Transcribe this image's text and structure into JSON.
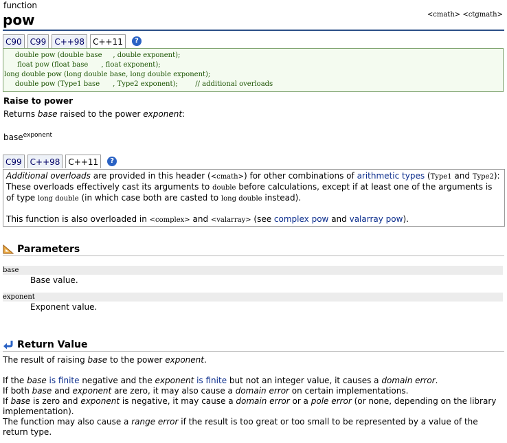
{
  "header": {
    "kind": "function",
    "title": "pow",
    "headers": "<cmath> <ctgmath>"
  },
  "tabs1": [
    "C90",
    "C99",
    "C++98",
    "C++11"
  ],
  "tabs1_active": "C++11",
  "help_label": "?",
  "prototypes": [
    "     double pow (double base     , double exponent);",
    "      float pow (float base      , float exponent);",
    "long double pow (long double base, long double exponent);",
    "     double pow (Type1 base      , Type2 exponent);        // additional overloads"
  ],
  "subtitle": "Raise to power",
  "description": {
    "pre": "Returns ",
    "base": "base",
    "mid": " raised to the power ",
    "exp": "exponent",
    "post": ":"
  },
  "formula": {
    "base": "base",
    "exp": "exponent"
  },
  "tabs2": [
    "C99",
    "C++98",
    "C++11"
  ],
  "tabs2_active": "C++11",
  "note": {
    "l1_em": "Additional overloads",
    "l1_a": " are provided in this header (",
    "l1_code": "<cmath>",
    "l1_b": ") for other combinations of ",
    "l1_link": "arithmetic types",
    "l1_c": " (",
    "l1_t1": "Type1",
    "l1_and": " and ",
    "l1_t2": "Type2",
    "l1_d": "):",
    "l2_a": "These overloads effectively cast its arguments to ",
    "l2_code": "double",
    "l2_b": " before calculations, except if at least one of the arguments is",
    "l3_a": "of type ",
    "l3_code1": "long double",
    "l3_b": " (in which case both are casted to ",
    "l3_code2": "long double",
    "l3_c": " instead).",
    "l4_a": "This function is also overloaded in ",
    "l4_code1": "<complex>",
    "l4_and": " and ",
    "l4_code2": "<valarray>",
    "l4_b": " (see ",
    "l4_link1": "complex pow",
    "l4_and2": " and ",
    "l4_link2": "valarray pow",
    "l4_c": ")."
  },
  "parameters": {
    "title": "Parameters",
    "items": [
      {
        "name": "base",
        "desc": "Base value."
      },
      {
        "name": "exponent",
        "desc": "Exponent value."
      }
    ]
  },
  "return_value": {
    "title": "Return Value",
    "p1_a": "The result of raising ",
    "p1_base": "base",
    "p1_b": " to the power ",
    "p1_exp": "exponent",
    "p1_c": ".",
    "p2_a": "If the ",
    "p2_base": "base",
    "p2_link1": " is finite",
    "p2_b": " negative and the ",
    "p2_exp": "exponent",
    "p2_link2": " is finite",
    "p2_c": " but not an integer value, it causes a ",
    "p2_err": "domain error",
    "p2_d": ".",
    "p3_a": "If both ",
    "p3_base": "base",
    "p3_b": " and ",
    "p3_exp": "exponent",
    "p3_c": " are zero, it may also cause a ",
    "p3_err": "domain error",
    "p3_d": " on certain implementations.",
    "p4_base": "base",
    "p4_a": "If ",
    "p4_b": " is zero and ",
    "p4_exp": "exponent",
    "p4_c": " is negative, it may cause a ",
    "p4_err1": "domain error",
    "p4_d": " or a ",
    "p4_err2": "pole error",
    "p4_e": " (or none, depending on the library",
    "p4_f": "implementation).",
    "p5_a": "The function may also cause a ",
    "p5_err": "range error",
    "p5_b": " if the result is too great or too small to be represented by a value of the",
    "p5_c": "return type."
  }
}
